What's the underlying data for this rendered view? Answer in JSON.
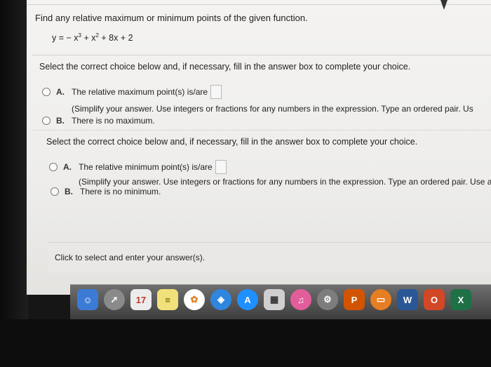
{
  "question": {
    "title": "Find any relative maximum or minimum points of the given function.",
    "equation": {
      "prefix": "y = − x",
      "exp1": "3",
      "mid": " + x",
      "exp2": "2",
      "suffix": " + 8x + 2"
    }
  },
  "part1": {
    "instruction": "Select the correct choice below and, if necessary, fill in the answer box to complete your choice.",
    "choice_a": {
      "letter": "A.",
      "text": "The relative maximum point(s) is/are",
      "note": "(Simplify your answer. Use integers or fractions for any numbers in the expression. Type an ordered pair. Us"
    },
    "choice_b": {
      "letter": "B.",
      "text": "There is no maximum."
    }
  },
  "part2": {
    "instruction": "Select the correct choice below and, if necessary, fill in the answer box to complete your choice.",
    "choice_a": {
      "letter": "A.",
      "text": "The relative minimum point(s) is/are",
      "note": "(Simplify your answer. Use integers or fractions for any numbers in the expression. Type an ordered pair. Use a"
    },
    "choice_b": {
      "letter": "B.",
      "text": "There is no minimum."
    }
  },
  "footer": {
    "text": "Click to select and enter your answer(s)."
  },
  "dock": {
    "calendar_day": "17",
    "letters": [
      "P",
      "W",
      "O",
      "X"
    ]
  }
}
